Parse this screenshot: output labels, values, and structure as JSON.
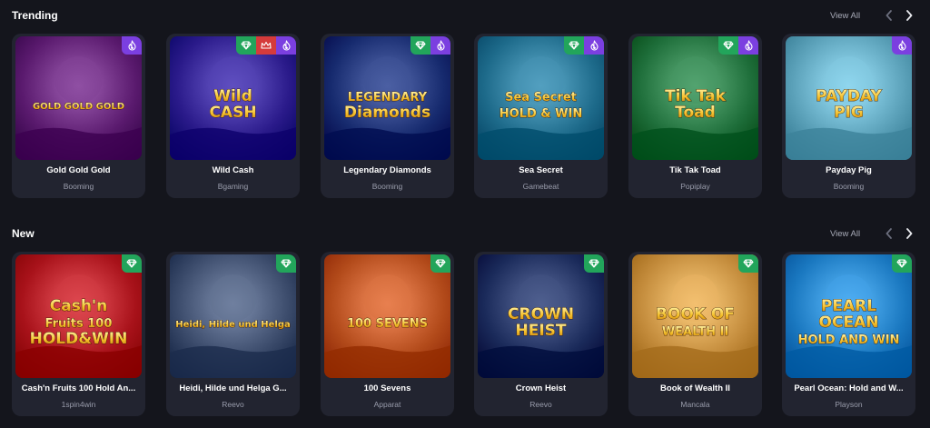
{
  "trending": {
    "title": "Trending",
    "view_all": "View All",
    "games": [
      {
        "title": "Gold Gold Gold",
        "provider": "Booming",
        "logo_lines": [
          "GOLD GOLD GOLD"
        ],
        "badges": [
          "hot"
        ],
        "bg": "#5a1a6e"
      },
      {
        "title": "Wild Cash",
        "provider": "Bgaming",
        "logo_lines": [
          "Wild",
          "CASH"
        ],
        "badges": [
          "gem",
          "crown",
          "hot"
        ],
        "bg": "#2a1a8a"
      },
      {
        "title": "Legendary Diamonds",
        "provider": "Booming",
        "logo_lines": [
          "LEGENDARY",
          "Diamonds"
        ],
        "badges": [
          "gem",
          "hot"
        ],
        "bg": "#162a6e"
      },
      {
        "title": "Sea Secret",
        "provider": "Gamebeat",
        "logo_lines": [
          "Sea Secret",
          "HOLD & WIN"
        ],
        "badges": [
          "gem",
          "hot"
        ],
        "bg": "#1d6a8a"
      },
      {
        "title": "Tik Tak Toad",
        "provider": "Popiplay",
        "logo_lines": [
          "Tik Tak",
          "Toad"
        ],
        "badges": [
          "gem",
          "hot"
        ],
        "bg": "#1e6e3a"
      },
      {
        "title": "Payday Pig",
        "provider": "Booming",
        "logo_lines": [
          "PAYDAY",
          "PIG"
        ],
        "badges": [
          "hot"
        ],
        "bg": "#5aa0b8"
      }
    ]
  },
  "new": {
    "title": "New",
    "view_all": "View All",
    "games": [
      {
        "title": "Cash'n Fruits 100 Hold An...",
        "provider": "1spin4win",
        "logo_lines": [
          "Cash'n",
          "Fruits 100",
          "HOLD&WIN"
        ],
        "badges": [
          "gem"
        ],
        "bg": "#a8121a"
      },
      {
        "title": "Heidi, Hilde und Helga G...",
        "provider": "Reevo",
        "logo_lines": [
          "Heidi, Hilde und Helga"
        ],
        "badges": [
          "gem"
        ],
        "bg": "#3a4a6a"
      },
      {
        "title": "100 Sevens",
        "provider": "Apparat",
        "logo_lines": [
          "100 SEVENS"
        ],
        "badges": [
          "gem"
        ],
        "bg": "#b24a1a"
      },
      {
        "title": "Crown Heist",
        "provider": "Reevo",
        "logo_lines": [
          "CROWN",
          "HEIST"
        ],
        "badges": [
          "gem"
        ],
        "bg": "#1a2a5a"
      },
      {
        "title": "Book of Wealth II",
        "provider": "Mancala",
        "logo_lines": [
          "BOOK OF",
          "WEALTH II"
        ],
        "badges": [
          "gem"
        ],
        "bg": "#c28a3a"
      },
      {
        "title": "Pearl Ocean: Hold and W...",
        "provider": "Playson",
        "logo_lines": [
          "PEARL",
          "OCEAN",
          "HOLD AND WIN"
        ],
        "badges": [
          "gem"
        ],
        "bg": "#1a78c0"
      }
    ]
  },
  "colors": {
    "background": "#14151c",
    "card": "#222430",
    "badge_gem": "#22a55b",
    "badge_crown": "#d53b3b",
    "badge_hot": "#7b3fe0",
    "muted_text": "#9a9dac"
  },
  "icons": {
    "prev": "chevron-left-icon",
    "next": "chevron-right-icon",
    "gem": "diamond-icon",
    "crown": "crown-icon",
    "hot": "flame-icon"
  }
}
